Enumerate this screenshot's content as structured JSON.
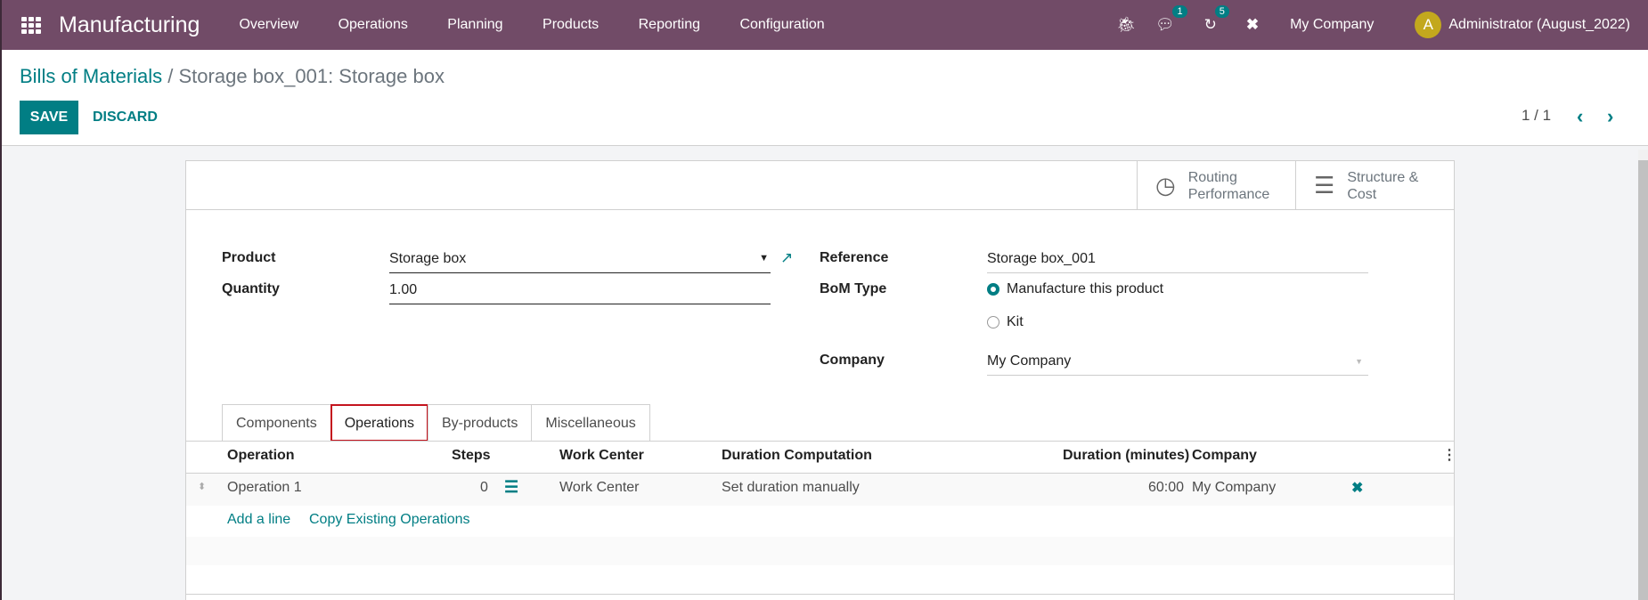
{
  "navbar": {
    "app_name": "Manufacturing",
    "menu": [
      "Overview",
      "Operations",
      "Planning",
      "Products",
      "Reporting",
      "Configuration"
    ],
    "icons": {
      "debug": "bug-icon",
      "messages": "chat-icon",
      "activities": "clock-icon",
      "tools": "tools-icon"
    },
    "messages_badge": "1",
    "activities_badge": "5",
    "company": "My Company",
    "avatar_initial": "A",
    "user": "Administrator (August_2022)",
    "brand_color": "#714b67",
    "accent_color": "#017e84"
  },
  "control_panel": {
    "breadcrumb_parent": "Bills of Materials",
    "breadcrumb_sep": " / ",
    "breadcrumb_current": "Storage box_001: Storage box",
    "save_label": "SAVE",
    "discard_label": "DISCARD",
    "pager": "1 / 1"
  },
  "smart_buttons": [
    {
      "label_line1": "Routing",
      "label_line2": "Performance",
      "icon": "clock-icon"
    },
    {
      "label_line1": "Structure &",
      "label_line2": "Cost",
      "icon": "bars-icon"
    }
  ],
  "form": {
    "product_label": "Product",
    "product_value": "Storage box",
    "quantity_label": "Quantity",
    "quantity_value": "1.00",
    "reference_label": "Reference",
    "reference_value": "Storage box_001",
    "bom_type_label": "BoM Type",
    "bom_type_options": [
      "Manufacture this product",
      "Kit"
    ],
    "bom_type_selected": "Manufacture this product",
    "company_label": "Company",
    "company_value": "My Company"
  },
  "tabs": [
    "Components",
    "Operations",
    "By-products",
    "Miscellaneous"
  ],
  "active_tab": "Operations",
  "operations_table": {
    "columns": [
      "Operation",
      "Steps",
      "Work Center",
      "Duration Computation",
      "Duration (minutes)",
      "Company"
    ],
    "rows": [
      {
        "operation": "Operation 1",
        "steps": "0",
        "work_center": "Work Center",
        "duration_computation": "Set duration manually",
        "duration": "60:00",
        "company": "My Company"
      }
    ],
    "add_line": "Add a line",
    "copy_existing": "Copy Existing Operations"
  }
}
